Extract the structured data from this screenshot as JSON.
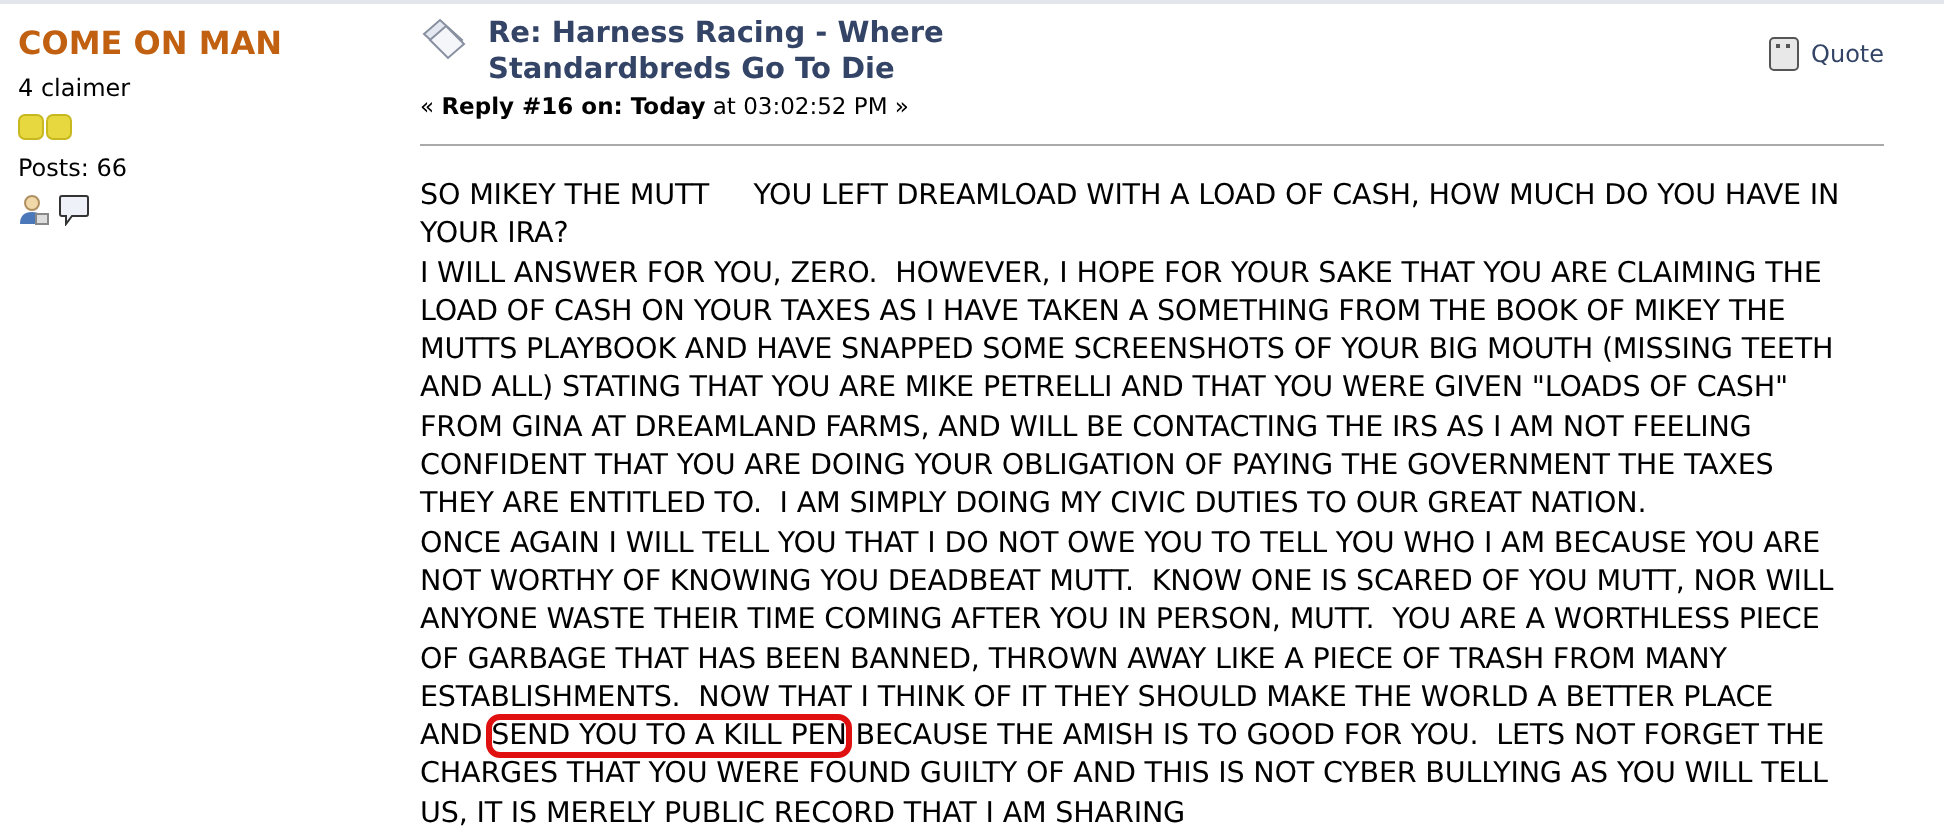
{
  "poster": {
    "name": "COME ON MAN",
    "rank": "4 claimer",
    "posts": "Posts: 66"
  },
  "post": {
    "title": "Re: Harness Racing - Where Standardbreds Go To Die",
    "reply_label": "Reply #16 on: Today",
    "time": " at 03:02:52 PM ",
    "open_mark": "«",
    "close_mark": "»",
    "quote_button": "Quote"
  },
  "body": [
    [
      {
        "text": "SO MIKEY THE MUTT     YOU LEFT DREAMLOAD WITH A LOAD OF CASH, HOW MUCH DO YOU HAVE IN YOUR IRA?",
        "highlighted": false
      }
    ],
    [
      {
        "text": "I WILL ANSWER FOR YOU, ZERO.  HOWEVER, I HOPE FOR YOUR SAKE THAT YOU ARE CLAIMING THE LOAD OF CASH ON YOUR TAXES AS I HAVE TAKEN A SOMETHING FROM THE BOOK OF MIKEY THE MUTTS PLAYBOOK AND HAVE SNAPPED SOME SCREENSHOTS OF YOUR BIG MOUTH (MISSING TEETH AND ALL) STATING THAT YOU ARE MIKE PETRELLI AND THAT YOU WERE GIVEN \"LOADS OF CASH\" FROM GINA AT DREAMLAND FARMS, AND WILL BE CONTACTING THE IRS AS I AM NOT FEELING CONFIDENT THAT YOU ARE DOING YOUR OBLIGATION OF PAYING THE GOVERNMENT THE TAXES THEY ARE ENTITLED TO.  I AM SIMPLY DOING MY CIVIC DUTIES TO OUR GREAT NATION.",
        "highlighted": false
      }
    ],
    [
      {
        "text": "ONCE AGAIN I WILL TELL YOU THAT I DO NOT OWE YOU TO TELL YOU WHO I AM BECAUSE YOU ARE NOT WORTHY OF KNOWING YOU DEADBEAT MUTT.  KNOW ONE IS SCARED OF YOU MUTT, NOR WILL ANYONE WASTE THEIR TIME COMING AFTER YOU IN PERSON, MUTT.  YOU ARE A WORTHLESS PIECE OF GARBAGE THAT HAS BEEN BANNED, THROWN AWAY LIKE A PIECE OF TRASH FROM MANY ESTABLISHMENTS.  NOW THAT I THINK OF IT THEY SHOULD MAKE THE WORLD A BETTER PLACE AND ",
        "highlighted": false
      },
      {
        "text": "SEND YOU TO A KILL PEN",
        "highlighted": true
      },
      {
        "text": " BECAUSE THE AMISH IS TO GOOD FOR YOU.  LETS NOT FORGET THE CHARGES THAT YOU WERE FOUND GUILTY OF AND THIS IS NOT CYBER BULLYING AS YOU WILL TELL US, IT IS MERELY PUBLIC RECORD THAT I AM SHARING",
        "highlighted": false
      }
    ]
  ]
}
